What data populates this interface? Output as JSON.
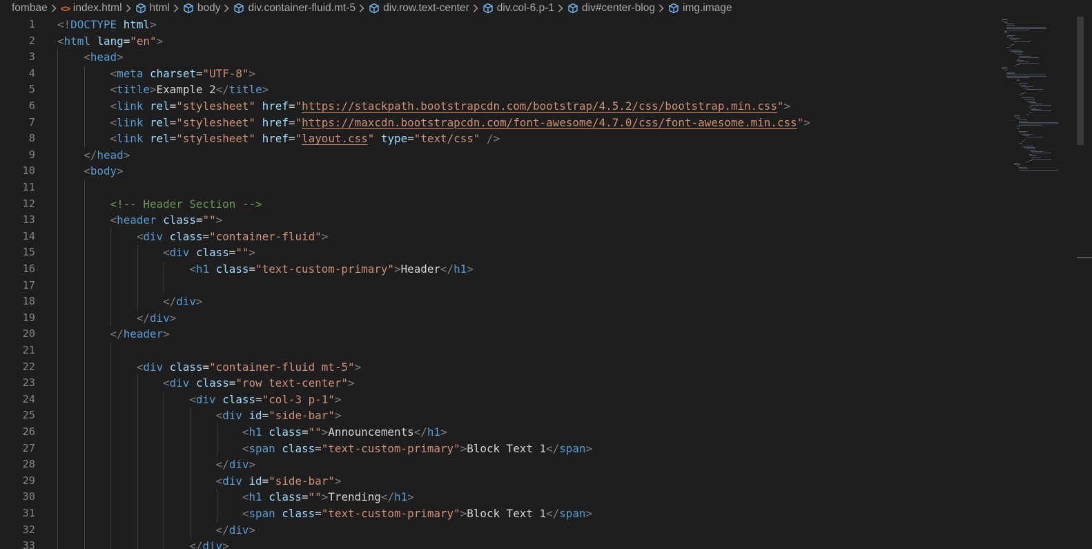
{
  "breadcrumb": [
    {
      "label": "fombae",
      "icon": null
    },
    {
      "label": "index.html",
      "icon": "html-file-icon"
    },
    {
      "label": "html",
      "icon": "symbol-element-icon"
    },
    {
      "label": "body",
      "icon": "symbol-element-icon"
    },
    {
      "label": "div.container-fluid.mt-5",
      "icon": "symbol-element-icon"
    },
    {
      "label": "div.row.text-center",
      "icon": "symbol-element-icon"
    },
    {
      "label": "div.col-6.p-1",
      "icon": "symbol-element-icon"
    },
    {
      "label": "div#center-blog",
      "icon": "symbol-element-icon"
    },
    {
      "label": "img.image",
      "icon": "symbol-element-icon"
    }
  ],
  "editor": {
    "lines": [
      {
        "n": "1",
        "tokens": [
          [
            "punct",
            "<!"
          ],
          [
            "tag",
            "DOCTYPE"
          ],
          [
            "text",
            " "
          ],
          [
            "attr",
            "html"
          ],
          [
            "punct",
            ">"
          ]
        ]
      },
      {
        "n": "2",
        "tokens": [
          [
            "punct",
            "<"
          ],
          [
            "tag",
            "html"
          ],
          [
            "text",
            " "
          ],
          [
            "attr",
            "lang"
          ],
          [
            "text",
            "="
          ],
          [
            "str",
            "\"en\""
          ],
          [
            "punct",
            ">"
          ]
        ]
      },
      {
        "n": "3",
        "tokens": [
          [
            "text",
            "    "
          ],
          [
            "punct",
            "<"
          ],
          [
            "tag",
            "head"
          ],
          [
            "punct",
            ">"
          ]
        ]
      },
      {
        "n": "4",
        "tokens": [
          [
            "text",
            "        "
          ],
          [
            "punct",
            "<"
          ],
          [
            "tag",
            "meta"
          ],
          [
            "text",
            " "
          ],
          [
            "attr",
            "charset"
          ],
          [
            "text",
            "="
          ],
          [
            "str",
            "\"UTF-8\""
          ],
          [
            "punct",
            ">"
          ]
        ]
      },
      {
        "n": "5",
        "tokens": [
          [
            "text",
            "        "
          ],
          [
            "punct",
            "<"
          ],
          [
            "tag",
            "title"
          ],
          [
            "punct",
            ">"
          ],
          [
            "text",
            "Example 2"
          ],
          [
            "punct",
            "</"
          ],
          [
            "tag",
            "title"
          ],
          [
            "punct",
            ">"
          ]
        ]
      },
      {
        "n": "6",
        "tokens": [
          [
            "text",
            "        "
          ],
          [
            "punct",
            "<"
          ],
          [
            "tag",
            "link"
          ],
          [
            "text",
            " "
          ],
          [
            "attr",
            "rel"
          ],
          [
            "text",
            "="
          ],
          [
            "str",
            "\"stylesheet\""
          ],
          [
            "text",
            " "
          ],
          [
            "attr",
            "href"
          ],
          [
            "text",
            "="
          ],
          [
            "str",
            "\""
          ],
          [
            "strU",
            "https://stackpath.bootstrapcdn.com/bootstrap/4.5.2/css/bootstrap.min.css"
          ],
          [
            "str",
            "\""
          ],
          [
            "punct",
            ">"
          ]
        ]
      },
      {
        "n": "7",
        "tokens": [
          [
            "text",
            "        "
          ],
          [
            "punct",
            "<"
          ],
          [
            "tag",
            "link"
          ],
          [
            "text",
            " "
          ],
          [
            "attr",
            "rel"
          ],
          [
            "text",
            "="
          ],
          [
            "str",
            "\"stylesheet\""
          ],
          [
            "text",
            " "
          ],
          [
            "attr",
            "href"
          ],
          [
            "text",
            "="
          ],
          [
            "str",
            "\""
          ],
          [
            "strU",
            "https://maxcdn.bootstrapcdn.com/font-awesome/4.7.0/css/font-awesome.min.css"
          ],
          [
            "str",
            "\""
          ],
          [
            "punct",
            ">"
          ]
        ]
      },
      {
        "n": "8",
        "tokens": [
          [
            "text",
            "        "
          ],
          [
            "punct",
            "<"
          ],
          [
            "tag",
            "link"
          ],
          [
            "text",
            " "
          ],
          [
            "attr",
            "rel"
          ],
          [
            "text",
            "="
          ],
          [
            "str",
            "\"stylesheet\""
          ],
          [
            "text",
            " "
          ],
          [
            "attr",
            "href"
          ],
          [
            "text",
            "="
          ],
          [
            "str",
            "\""
          ],
          [
            "strU",
            "layout.css"
          ],
          [
            "str",
            "\""
          ],
          [
            "text",
            " "
          ],
          [
            "attr",
            "type"
          ],
          [
            "text",
            "="
          ],
          [
            "str",
            "\"text/css\""
          ],
          [
            "text",
            " "
          ],
          [
            "punct",
            "/>"
          ]
        ]
      },
      {
        "n": "9",
        "tokens": [
          [
            "text",
            "    "
          ],
          [
            "punct",
            "</"
          ],
          [
            "tag",
            "head"
          ],
          [
            "punct",
            ">"
          ]
        ]
      },
      {
        "n": "10",
        "tokens": [
          [
            "text",
            "    "
          ],
          [
            "punct",
            "<"
          ],
          [
            "tag",
            "body"
          ],
          [
            "punct",
            ">"
          ]
        ]
      },
      {
        "n": "11",
        "tokens": []
      },
      {
        "n": "12",
        "tokens": [
          [
            "text",
            "        "
          ],
          [
            "comment",
            "<!-- Header Section -->"
          ]
        ]
      },
      {
        "n": "13",
        "tokens": [
          [
            "text",
            "        "
          ],
          [
            "punct",
            "<"
          ],
          [
            "tag",
            "header"
          ],
          [
            "text",
            " "
          ],
          [
            "attr",
            "class"
          ],
          [
            "text",
            "="
          ],
          [
            "str",
            "\"\""
          ],
          [
            "punct",
            ">"
          ]
        ]
      },
      {
        "n": "14",
        "tokens": [
          [
            "text",
            "            "
          ],
          [
            "punct",
            "<"
          ],
          [
            "tag",
            "div"
          ],
          [
            "text",
            " "
          ],
          [
            "attr",
            "class"
          ],
          [
            "text",
            "="
          ],
          [
            "str",
            "\"container-fluid\""
          ],
          [
            "punct",
            ">"
          ]
        ]
      },
      {
        "n": "15",
        "tokens": [
          [
            "text",
            "                "
          ],
          [
            "punct",
            "<"
          ],
          [
            "tag",
            "div"
          ],
          [
            "text",
            " "
          ],
          [
            "attr",
            "class"
          ],
          [
            "text",
            "="
          ],
          [
            "str",
            "\"\""
          ],
          [
            "punct",
            ">"
          ]
        ]
      },
      {
        "n": "16",
        "tokens": [
          [
            "text",
            "                    "
          ],
          [
            "punct",
            "<"
          ],
          [
            "tag",
            "h1"
          ],
          [
            "text",
            " "
          ],
          [
            "attr",
            "class"
          ],
          [
            "text",
            "="
          ],
          [
            "str",
            "\"text-custom-primary\""
          ],
          [
            "punct",
            ">"
          ],
          [
            "text",
            "Header"
          ],
          [
            "punct",
            "</"
          ],
          [
            "tag",
            "h1"
          ],
          [
            "punct",
            ">"
          ]
        ]
      },
      {
        "n": "17",
        "tokens": []
      },
      {
        "n": "18",
        "tokens": [
          [
            "text",
            "                "
          ],
          [
            "punct",
            "</"
          ],
          [
            "tag",
            "div"
          ],
          [
            "punct",
            ">"
          ]
        ]
      },
      {
        "n": "19",
        "tokens": [
          [
            "text",
            "            "
          ],
          [
            "punct",
            "</"
          ],
          [
            "tag",
            "div"
          ],
          [
            "punct",
            ">"
          ]
        ]
      },
      {
        "n": "20",
        "tokens": [
          [
            "text",
            "        "
          ],
          [
            "punct",
            "</"
          ],
          [
            "tag",
            "header"
          ],
          [
            "punct",
            ">"
          ]
        ]
      },
      {
        "n": "21",
        "tokens": []
      },
      {
        "n": "22",
        "tokens": [
          [
            "text",
            "            "
          ],
          [
            "punct",
            "<"
          ],
          [
            "tag",
            "div"
          ],
          [
            "text",
            " "
          ],
          [
            "attr",
            "class"
          ],
          [
            "text",
            "="
          ],
          [
            "str",
            "\"container-fluid mt-5\""
          ],
          [
            "punct",
            ">"
          ]
        ]
      },
      {
        "n": "23",
        "tokens": [
          [
            "text",
            "                "
          ],
          [
            "punct",
            "<"
          ],
          [
            "tag",
            "div"
          ],
          [
            "text",
            " "
          ],
          [
            "attr",
            "class"
          ],
          [
            "text",
            "="
          ],
          [
            "str",
            "\"row text-center\""
          ],
          [
            "punct",
            ">"
          ]
        ]
      },
      {
        "n": "24",
        "tokens": [
          [
            "text",
            "                    "
          ],
          [
            "punct",
            "<"
          ],
          [
            "tag",
            "div"
          ],
          [
            "text",
            " "
          ],
          [
            "attr",
            "class"
          ],
          [
            "text",
            "="
          ],
          [
            "str",
            "\"col-3 p-1\""
          ],
          [
            "punct",
            ">"
          ]
        ]
      },
      {
        "n": "25",
        "tokens": [
          [
            "text",
            "                        "
          ],
          [
            "punct",
            "<"
          ],
          [
            "tag",
            "div"
          ],
          [
            "text",
            " "
          ],
          [
            "attr",
            "id"
          ],
          [
            "text",
            "="
          ],
          [
            "str",
            "\"side-bar\""
          ],
          [
            "punct",
            ">"
          ]
        ]
      },
      {
        "n": "26",
        "tokens": [
          [
            "text",
            "                            "
          ],
          [
            "punct",
            "<"
          ],
          [
            "tag",
            "h1"
          ],
          [
            "text",
            " "
          ],
          [
            "attr",
            "class"
          ],
          [
            "text",
            "="
          ],
          [
            "str",
            "\"\""
          ],
          [
            "punct",
            ">"
          ],
          [
            "text",
            "Announcements"
          ],
          [
            "punct",
            "</"
          ],
          [
            "tag",
            "h1"
          ],
          [
            "punct",
            ">"
          ]
        ]
      },
      {
        "n": "27",
        "tokens": [
          [
            "text",
            "                            "
          ],
          [
            "punct",
            "<"
          ],
          [
            "tag",
            "span"
          ],
          [
            "text",
            " "
          ],
          [
            "attr",
            "class"
          ],
          [
            "text",
            "="
          ],
          [
            "str",
            "\"text-custom-primary\""
          ],
          [
            "punct",
            ">"
          ],
          [
            "text",
            "Block Text 1"
          ],
          [
            "punct",
            "</"
          ],
          [
            "tag",
            "span"
          ],
          [
            "punct",
            ">"
          ]
        ]
      },
      {
        "n": "28",
        "tokens": [
          [
            "text",
            "                        "
          ],
          [
            "punct",
            "</"
          ],
          [
            "tag",
            "div"
          ],
          [
            "punct",
            ">"
          ]
        ]
      },
      {
        "n": "29",
        "tokens": [
          [
            "text",
            "                        "
          ],
          [
            "punct",
            "<"
          ],
          [
            "tag",
            "div"
          ],
          [
            "text",
            " "
          ],
          [
            "attr",
            "id"
          ],
          [
            "text",
            "="
          ],
          [
            "str",
            "\"side-bar\""
          ],
          [
            "punct",
            ">"
          ]
        ]
      },
      {
        "n": "30",
        "tokens": [
          [
            "text",
            "                            "
          ],
          [
            "punct",
            "<"
          ],
          [
            "tag",
            "h1"
          ],
          [
            "text",
            " "
          ],
          [
            "attr",
            "class"
          ],
          [
            "text",
            "="
          ],
          [
            "str",
            "\"\""
          ],
          [
            "punct",
            ">"
          ],
          [
            "text",
            "Trending"
          ],
          [
            "punct",
            "</"
          ],
          [
            "tag",
            "h1"
          ],
          [
            "punct",
            ">"
          ]
        ]
      },
      {
        "n": "31",
        "tokens": [
          [
            "text",
            "                            "
          ],
          [
            "punct",
            "<"
          ],
          [
            "tag",
            "span"
          ],
          [
            "text",
            " "
          ],
          [
            "attr",
            "class"
          ],
          [
            "text",
            "="
          ],
          [
            "str",
            "\"text-custom-primary\""
          ],
          [
            "punct",
            ">"
          ],
          [
            "text",
            "Block Text 1"
          ],
          [
            "punct",
            "</"
          ],
          [
            "tag",
            "span"
          ],
          [
            "punct",
            ">"
          ]
        ]
      },
      {
        "n": "32",
        "tokens": [
          [
            "text",
            "                        "
          ],
          [
            "punct",
            "</"
          ],
          [
            "tag",
            "div"
          ],
          [
            "punct",
            ">"
          ]
        ]
      },
      {
        "n": "33",
        "tokens": [
          [
            "text",
            "                    "
          ],
          [
            "punct",
            "</"
          ],
          [
            "tag",
            "div"
          ],
          [
            "punct",
            ">"
          ]
        ]
      }
    ]
  }
}
